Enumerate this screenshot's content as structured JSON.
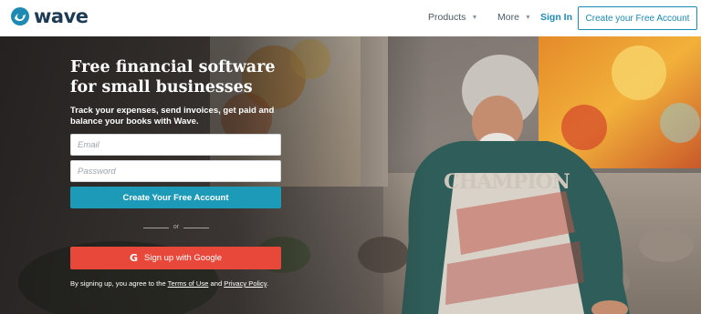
{
  "header": {
    "logo_text": "wave",
    "nav": {
      "products_label": "Products",
      "features_label": "More",
      "signin_label": "Sign In",
      "cta_label": "Create your Free Account"
    }
  },
  "hero": {
    "title_line1": "Free financial software",
    "title_line2": "for small businesses",
    "subtitle": "Track your expenses, send invoices, get paid and balance your books with Wave.",
    "email_placeholder": "Email",
    "password_placeholder": "Password",
    "create_button_label": "Create Your Free Account",
    "divider_text": "or",
    "google_button_label": "Sign up with Google",
    "google_icon_glyph": "G",
    "legal": {
      "prefix": "By signing up, you agree to the ",
      "terms_label": "Terms of Use",
      "middle": " and ",
      "privacy_label": "Privacy Policy",
      "suffix": "."
    },
    "background_text": "CHAMPION"
  },
  "colors": {
    "accent": "#1c8ab3",
    "primary_button": "#1e9ab9",
    "google_button": "#e7483a",
    "logo": "#1d3b55"
  }
}
